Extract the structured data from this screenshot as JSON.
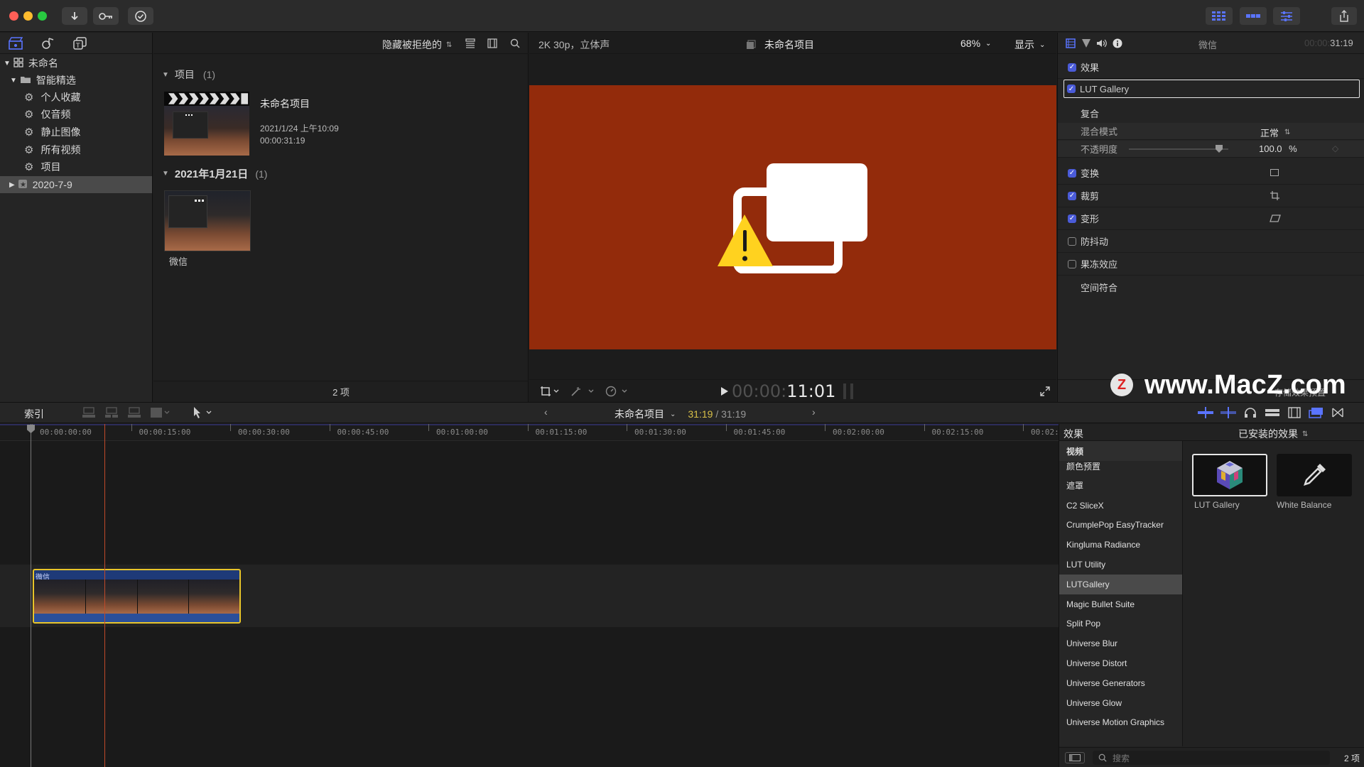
{
  "colors": {
    "accent": "#4a5bd8",
    "viewer_bg": "#932b0b",
    "playhead": "#c04a2a",
    "clip_border": "#e8c52a",
    "timecode_yellow": "#d8c048"
  },
  "library": {
    "root_name": "未命名",
    "smart_collections_label": "智能精选",
    "items": [
      {
        "label": "个人收藏",
        "icon": "gear-icon"
      },
      {
        "label": "仅音频",
        "icon": "gear-icon"
      },
      {
        "label": "静止图像",
        "icon": "gear-icon"
      },
      {
        "label": "所有视频",
        "icon": "gear-icon"
      },
      {
        "label": "项目",
        "icon": "gear-icon"
      }
    ],
    "event_name": "2020-7-9"
  },
  "browser": {
    "filter_label": "隐藏被拒绝的",
    "section1_title": "项目",
    "section1_count": "(1)",
    "project_name": "未命名项目",
    "project_date": "2021/1/24 上午10:09",
    "project_duration": "00:00:31:19",
    "section2_title": "2021年1月21日",
    "section2_count": "(1)",
    "clip_name": "微信",
    "footer_count": "2 项"
  },
  "viewer": {
    "format": "2K 30p，立体声",
    "project_title": "未命名项目",
    "zoom": "68%",
    "display_label": "显示",
    "timecode_dim": "00:00:",
    "timecode_bright": "11:01"
  },
  "inspector": {
    "clip_name": "微信",
    "duration_dim": "00:00:",
    "duration": "31:19",
    "effects_label": "效果",
    "lut_label": "LUT Gallery",
    "composite_label": "复合",
    "blend_label": "混合模式",
    "blend_value": "正常",
    "opacity_label": "不透明度",
    "opacity_value": "100.0",
    "opacity_unit": "%",
    "transform_label": "变换",
    "crop_label": "裁剪",
    "distort_label": "变形",
    "stabilize_label": "防抖动",
    "rolling_label": "果冻效应",
    "spatial_label": "空间符合"
  },
  "watermark": {
    "logo_letter": "Z",
    "text": "www.MacZ.com",
    "overlap_text": "存储效果预置"
  },
  "timeline_bar": {
    "index_label": "索引",
    "project_name": "未命名项目",
    "time_current": "31:19",
    "time_sep": " / ",
    "time_total": "31:19"
  },
  "ruler": [
    "00:00:00:00",
    "00:00:15:00",
    "00:00:30:00",
    "00:00:45:00",
    "00:01:00:00",
    "00:01:15:00",
    "00:01:30:00",
    "00:01:45:00",
    "00:02:00:00",
    "00:02:15:00",
    "00:02:"
  ],
  "clip_label": "微信",
  "effects": {
    "header": "效果",
    "installed_label": "已安装的效果",
    "categories": [
      "视频",
      "颜色预置",
      "遮罩",
      "C2 SliceX",
      "CrumplePop EasyTracker",
      "Kingluma Radiance",
      "LUT Utility",
      "LUTGallery",
      "Magic Bullet Suite",
      "Split Pop",
      "Universe Blur",
      "Universe Distort",
      "Universe Generators",
      "Universe Glow",
      "Universe Motion Graphics"
    ],
    "selected_index": 7,
    "items": [
      {
        "name": "LUT Gallery"
      },
      {
        "name": "White Balance"
      }
    ],
    "search_placeholder": "搜索",
    "count": "2 项"
  }
}
